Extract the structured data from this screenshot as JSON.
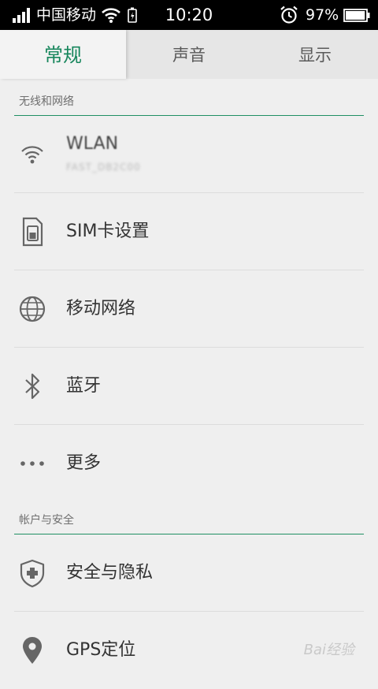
{
  "status_bar": {
    "carrier": "中国移动",
    "time": "10:20",
    "battery_percent": "97%",
    "battery_level": 0.97
  },
  "tabs": [
    {
      "label": "常规",
      "active": true
    },
    {
      "label": "声音",
      "active": false
    },
    {
      "label": "显示",
      "active": false
    }
  ],
  "sections": {
    "wireless_network": {
      "title": "无线和网络",
      "items": [
        {
          "label": "WLAN",
          "sublabel": "FAST_DB2C00",
          "icon": "wifi-icon"
        },
        {
          "label": "SIM卡设置",
          "icon": "sim-card-icon"
        },
        {
          "label": "移动网络",
          "icon": "globe-icon"
        },
        {
          "label": "蓝牙",
          "icon": "bluetooth-icon"
        },
        {
          "label": "更多",
          "icon": "more-icon"
        }
      ]
    },
    "account_security": {
      "title": "帐户与安全",
      "items": [
        {
          "label": "安全与隐私",
          "icon": "shield-icon"
        },
        {
          "label": "GPS定位",
          "icon": "location-pin-icon"
        }
      ]
    }
  },
  "colors": {
    "accent": "#17865c",
    "background": "#efefef",
    "tab_bar": "#e6e6e6",
    "status_bar": "#000000"
  },
  "watermark": "Bai经验"
}
